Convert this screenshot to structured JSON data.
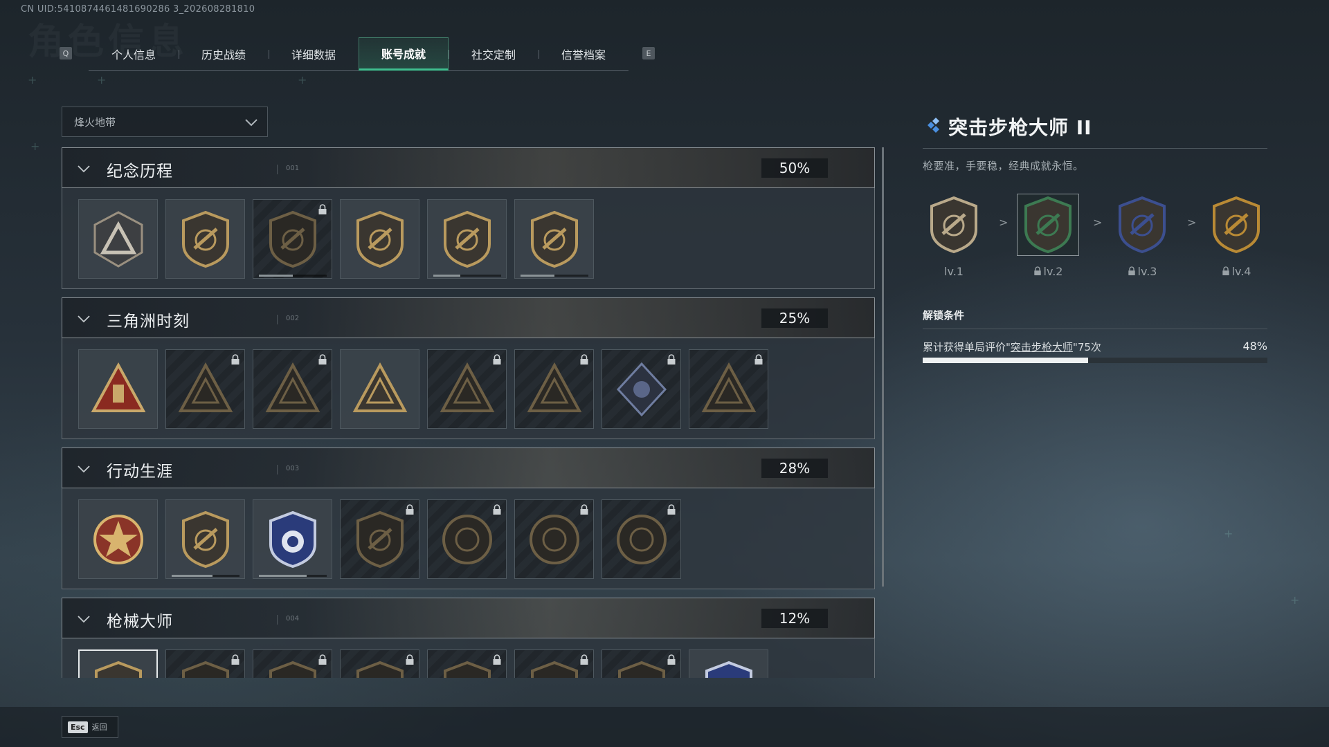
{
  "uid": "CN UID:5410874461481690286 3_202608281810",
  "watermark": "角色信息",
  "tabs": {
    "left_key": "Q",
    "right_key": "E",
    "items": [
      "个人信息",
      "历史战绩",
      "详细数据",
      "账号成就",
      "社交定制",
      "信誉档案"
    ],
    "active": "账号成就"
  },
  "mode_select": {
    "value": "烽火地带"
  },
  "sections": [
    {
      "title": "纪念历程",
      "num": "001",
      "percent": "50%"
    },
    {
      "title": "三角洲时刻",
      "num": "002",
      "percent": "25%"
    },
    {
      "title": "行动生涯",
      "num": "003",
      "percent": "28%"
    },
    {
      "title": "枪械大师",
      "num": "004",
      "percent": "12%"
    }
  ],
  "achievements": {
    "memorial": [
      {
        "icon": "triangle-a-badge-icon",
        "locked": false
      },
      {
        "icon": "helicopter-badge-icon",
        "locked": false
      },
      {
        "icon": "shield-emblem-badge-icon",
        "locked": true,
        "progress": 0.5
      },
      {
        "icon": "number-one-triangle-badge-icon",
        "locked": false
      },
      {
        "icon": "delta-force-vehicle-badge-icon",
        "locked": false,
        "progress": 0.4
      },
      {
        "icon": "delta-force-2026-badge-icon",
        "locked": false,
        "progress": 0.5
      }
    ],
    "delta_moments": [
      {
        "icon": "triangle-tower-badge-icon",
        "locked": false
      },
      {
        "icon": "triangle-soldier-badge-icon",
        "locked": true
      },
      {
        "icon": "triangle-target-badge-icon",
        "locked": true
      },
      {
        "icon": "triangle-squad-badge-icon",
        "locked": false
      },
      {
        "icon": "triangle-animals-badge-icon",
        "locked": true
      },
      {
        "icon": "triangle-fish-badge-icon",
        "locked": true
      },
      {
        "icon": "diamond-rose-badge-icon",
        "locked": true
      },
      {
        "icon": "triangle-dragon-badge-icon",
        "locked": true
      }
    ],
    "career": [
      {
        "icon": "star-medal-badge-icon",
        "locked": false
      },
      {
        "icon": "shield-wings-badge-icon",
        "locked": false,
        "progress": 0.6
      },
      {
        "icon": "blue-star-shield-badge-icon",
        "locked": false,
        "progress": 0.7
      },
      {
        "icon": "dark-shield-badge-icon",
        "locked": true
      },
      {
        "icon": "round-helmet-badge-icon",
        "locked": true
      },
      {
        "icon": "round-crosshair-badge-icon",
        "locked": true
      },
      {
        "icon": "round-eye-badge-icon",
        "locked": true
      }
    ],
    "gun_master": [
      {
        "icon": "rifle-shield-badge-icon",
        "locked": false,
        "selected": true
      },
      {
        "icon": "rifle-shield-badge-icon",
        "locked": true
      },
      {
        "icon": "rifle-shield-badge-icon",
        "locked": true
      },
      {
        "icon": "rifle-shield-badge-icon",
        "locked": true
      },
      {
        "icon": "rifle-shield-badge-icon",
        "locked": true
      },
      {
        "icon": "rifle-shield-badge-icon",
        "locked": true
      },
      {
        "icon": "rifle-shield-badge-icon",
        "locked": true
      },
      {
        "icon": "crosshair-shield-badge-icon",
        "locked": false
      }
    ]
  },
  "detail": {
    "title": "突击步枪大师 II",
    "description": "枪要准，手要稳，经典成就永恒。",
    "levels": [
      {
        "label": "lv.1",
        "locked": false,
        "color": "#b9a98a"
      },
      {
        "label": "lv.2",
        "locked": true,
        "color": "#3d7a52"
      },
      {
        "label": "lv.3",
        "locked": true,
        "color": "#3c4f8f"
      },
      {
        "label": "lv.4",
        "locked": true,
        "color": "#b98a35"
      }
    ],
    "arrow": ">",
    "unlock_heading": "解锁条件",
    "condition_prefix": "累计获得单局评价\"",
    "condition_link": "突击步枪大师",
    "condition_suffix": "\"75次",
    "progress_text": "48%",
    "progress": 0.48
  },
  "footer": {
    "key": "Esc",
    "label": "返回"
  },
  "colors": {
    "accent_green": "#3fbf8f",
    "gold": "#b99a5e",
    "accent_blue": "#4a8fe0"
  }
}
